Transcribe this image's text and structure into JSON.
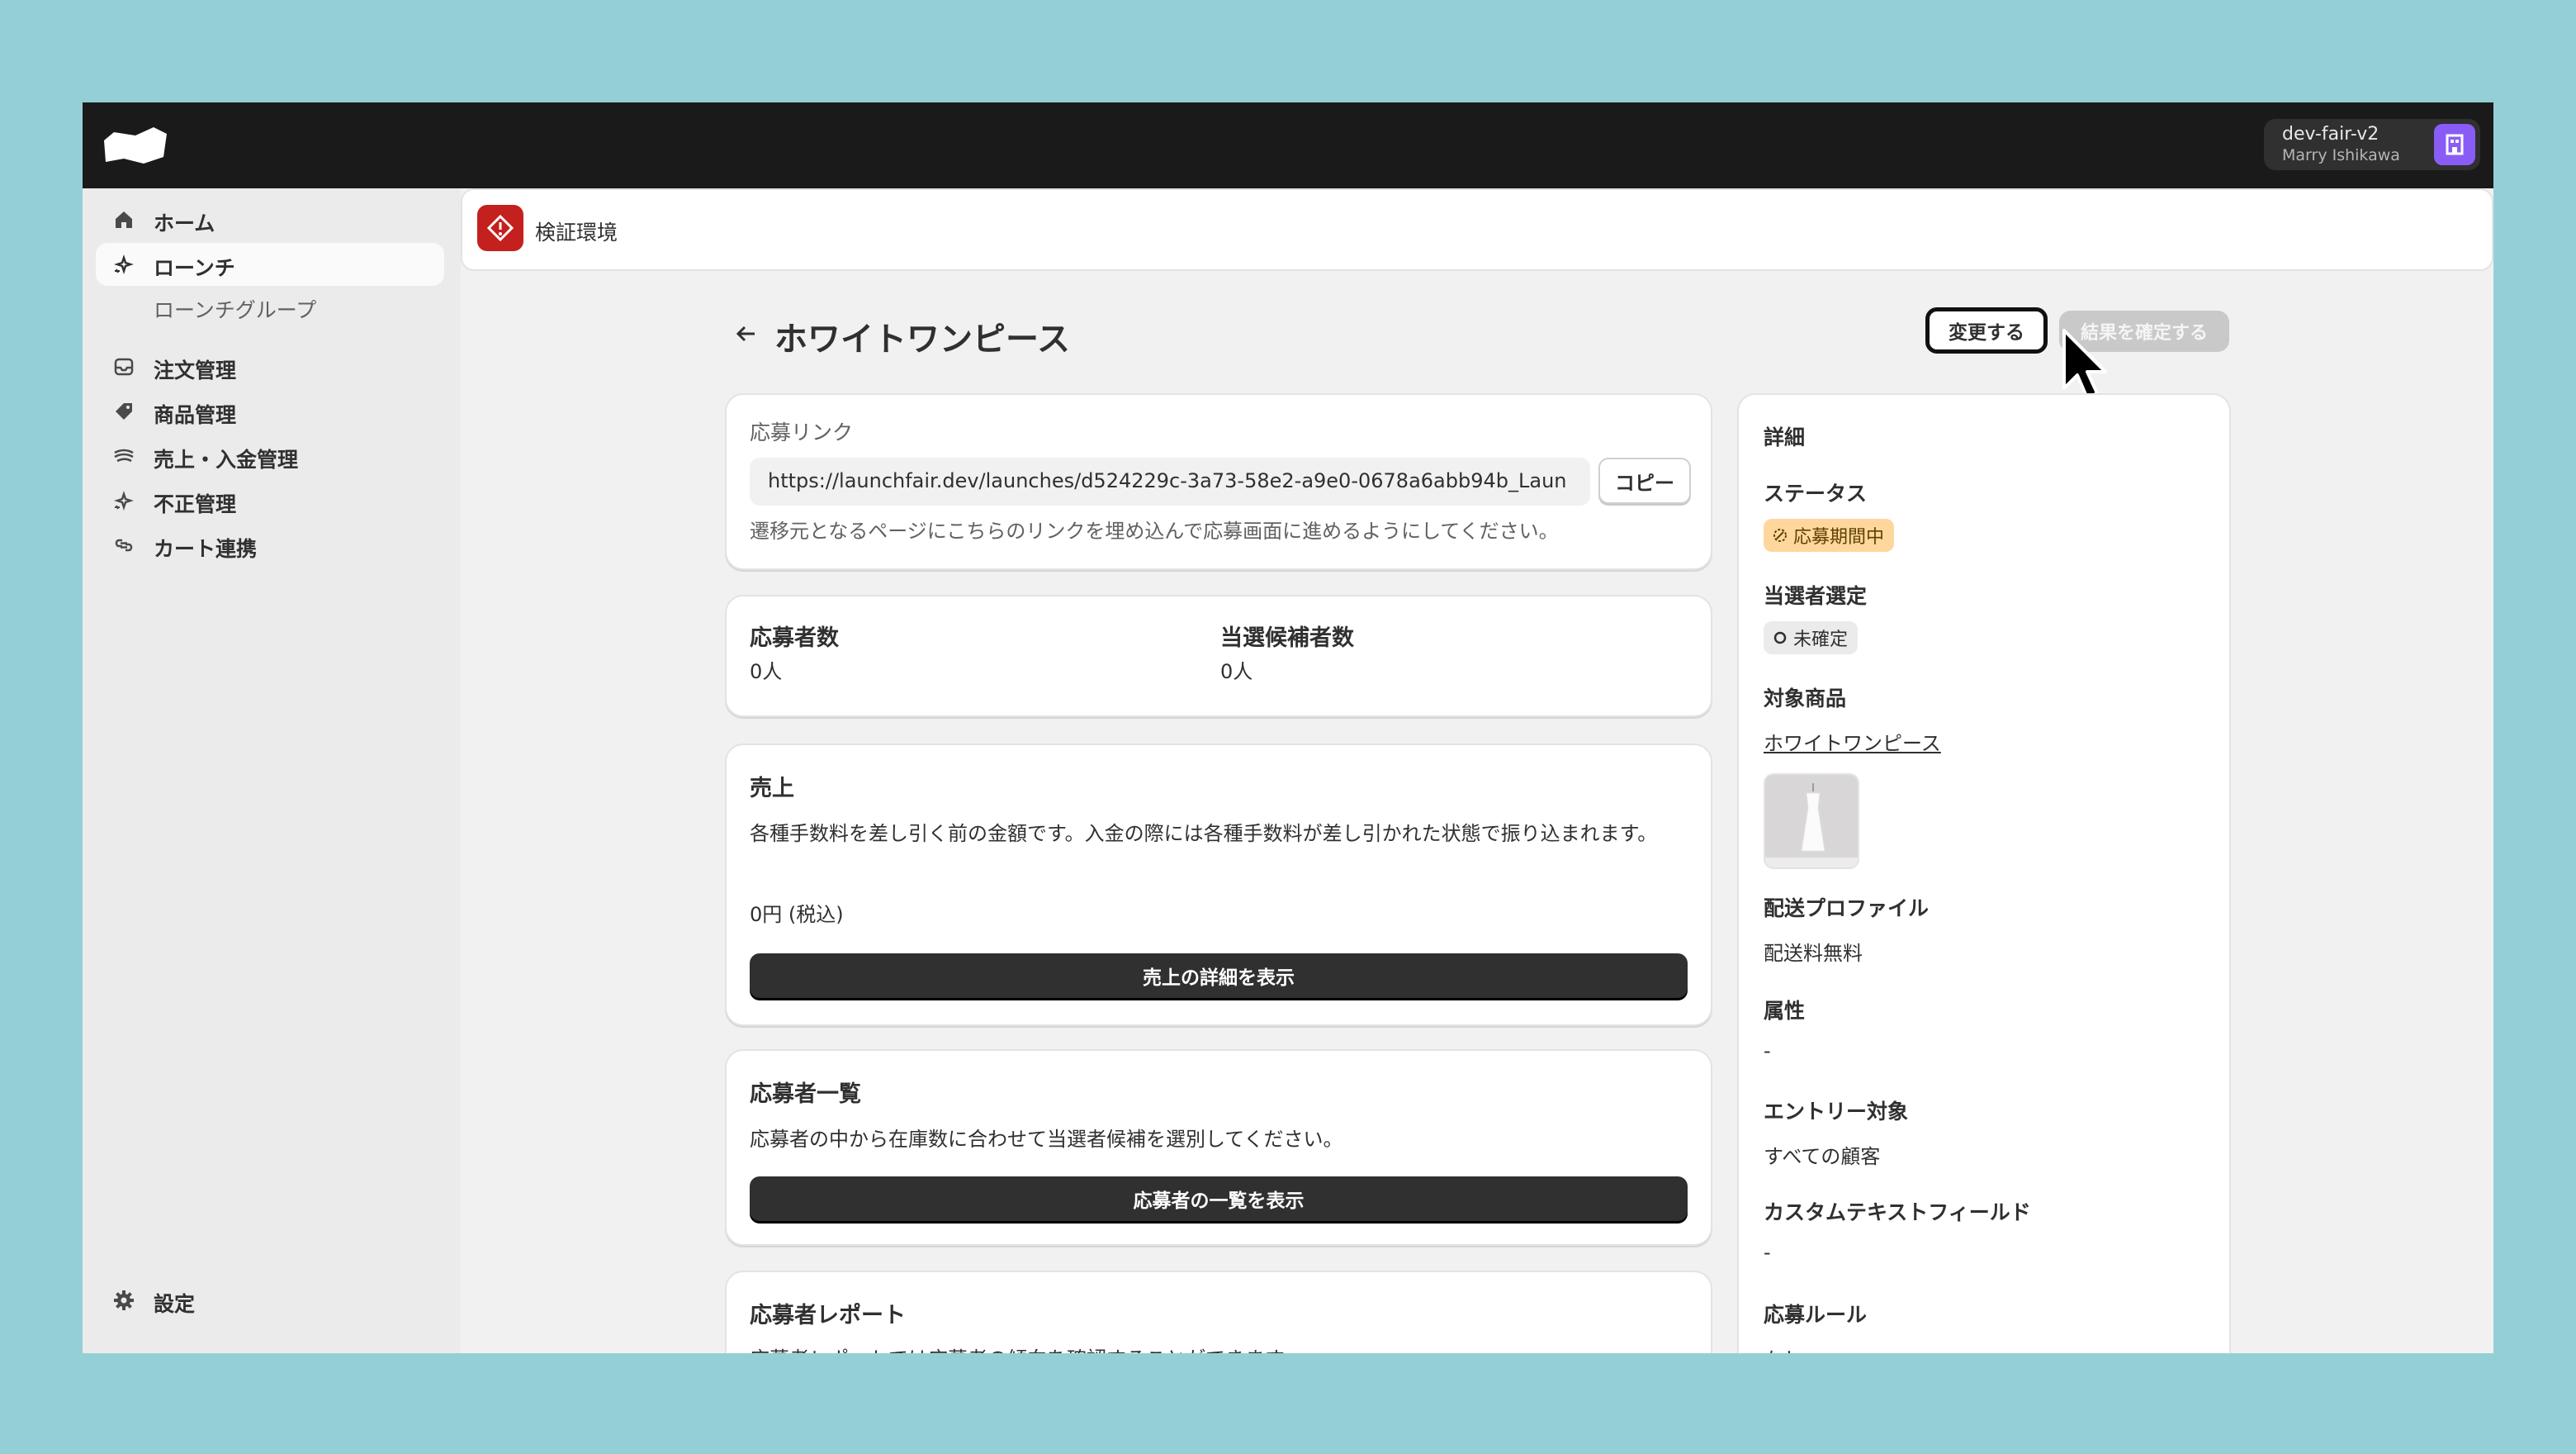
{
  "store": {
    "name": "dev-fair-v2",
    "user": "Marry Ishikawa"
  },
  "nav": {
    "items": [
      {
        "label": "ホーム",
        "icon": "home-icon"
      },
      {
        "label": "ローンチ",
        "icon": "sparkle-icon"
      },
      {
        "label": "ローンチグループ"
      },
      {
        "label": "注文管理",
        "icon": "inbox-icon"
      },
      {
        "label": "商品管理",
        "icon": "tag-icon"
      },
      {
        "label": "売上・入金管理",
        "icon": "cash-icon"
      },
      {
        "label": "不正管理",
        "icon": "sparkle-icon"
      },
      {
        "label": "カート連携",
        "icon": "link-icon"
      }
    ],
    "settings": "設定"
  },
  "env": {
    "label": "検証環境"
  },
  "page": {
    "title": "ホワイトワンピース"
  },
  "actions": {
    "change": "変更する",
    "confirm": "結果を確定する"
  },
  "entry_link": {
    "label": "応募リンク",
    "url": "https://launchfair.dev/launches/d524229c-3a73-58e2-a9e0-0678a6abb94b_Laun",
    "copy": "コピー",
    "help": "遷移元となるページにこちらのリンクを埋め込んで応募画面に進めるようにしてください。"
  },
  "stats": {
    "applicants_label": "応募者数",
    "applicants_value": "0人",
    "candidates_label": "当選候補者数",
    "candidates_value": "0人"
  },
  "sales": {
    "title": "売上",
    "desc": "各種手数料を差し引く前の金額です。入金の際には各種手数料が差し引かれた状態で振り込まれます。",
    "amount": "0円 (税込)",
    "button": "売上の詳細を表示"
  },
  "applicants": {
    "title": "応募者一覧",
    "desc": "応募者の中から在庫数に合わせて当選者候補を選別してください。",
    "button": "応募者の一覧を表示"
  },
  "report": {
    "title": "応募者レポート",
    "desc": "応募者レポートでは応募者の傾向を確認することができます。"
  },
  "details": {
    "title": "詳細",
    "status_label": "ステータス",
    "status_value": "応募期間中",
    "selection_label": "当選者選定",
    "selection_value": "未確定",
    "product_label": "対象商品",
    "product_value": "ホワイトワンピース",
    "shipping_label": "配送プロファイル",
    "shipping_value": "配送料無料",
    "attr_label": "属性",
    "attr_value": "-",
    "entry_label": "エントリー対象",
    "entry_value": "すべての顧客",
    "custom_label": "カスタムテキストフィールド",
    "custom_value": "-",
    "rule_label": "応募ルール",
    "rule_value": "なし"
  },
  "colors": {
    "accent": "#303030",
    "brand_env": "#c4201d",
    "warning_badge": "#ffd79d",
    "link": "#005bd3",
    "avatar": "#8a5cf6"
  }
}
